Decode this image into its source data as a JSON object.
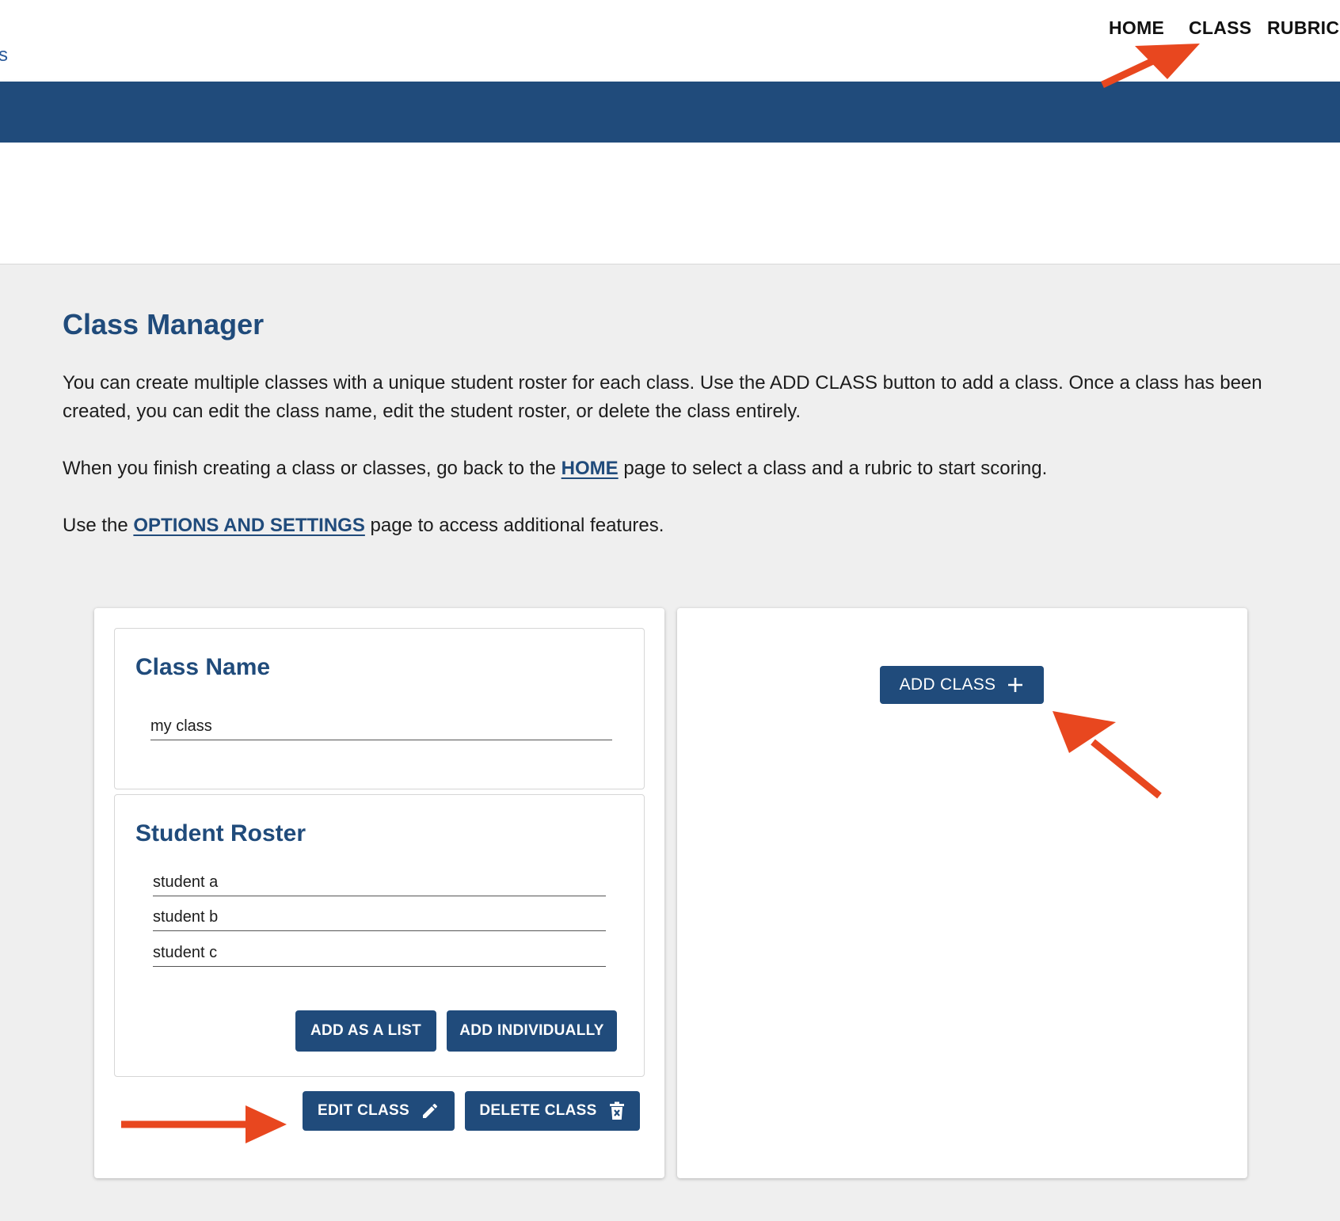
{
  "header": {
    "edge_fragment": "s",
    "nav": {
      "home": "HOME",
      "class": "CLASS",
      "rubric": "RUBRIC"
    }
  },
  "main": {
    "title": "Class Manager",
    "para1": "You can create multiple classes with a unique student roster for each class. Use the ADD CLASS button to add a class. Once a class has been created, you can edit the class name, edit the student roster, or delete the class entirely.",
    "para2": {
      "before": "When you finish creating a class or classes, go back to the ",
      "link": "HOME",
      "after": " page to select a class and a rubric to start scoring."
    },
    "para3": {
      "before": "Use the ",
      "link": "OPTIONS AND SETTINGS",
      "after": " page to access additional features."
    }
  },
  "class_card": {
    "class_name_title": "Class Name",
    "class_name_value": "my class",
    "roster_title": "Student Roster",
    "students": [
      "student a",
      "student b",
      "student c"
    ],
    "add_as_list_label": "ADD AS A LIST",
    "add_individually_label": "ADD INDIVIDUALLY",
    "edit_class_label": "EDIT CLASS",
    "delete_class_label": "DELETE CLASS"
  },
  "add_card": {
    "add_class_label": "ADD CLASS"
  },
  "icons": {
    "edit": "pencil-icon",
    "delete": "trash-icon",
    "add": "plus-icon",
    "annotation": "arrow-icon"
  },
  "colors": {
    "brand": "#204b7b",
    "annotation": "#e8471f",
    "background": "#efefef"
  }
}
